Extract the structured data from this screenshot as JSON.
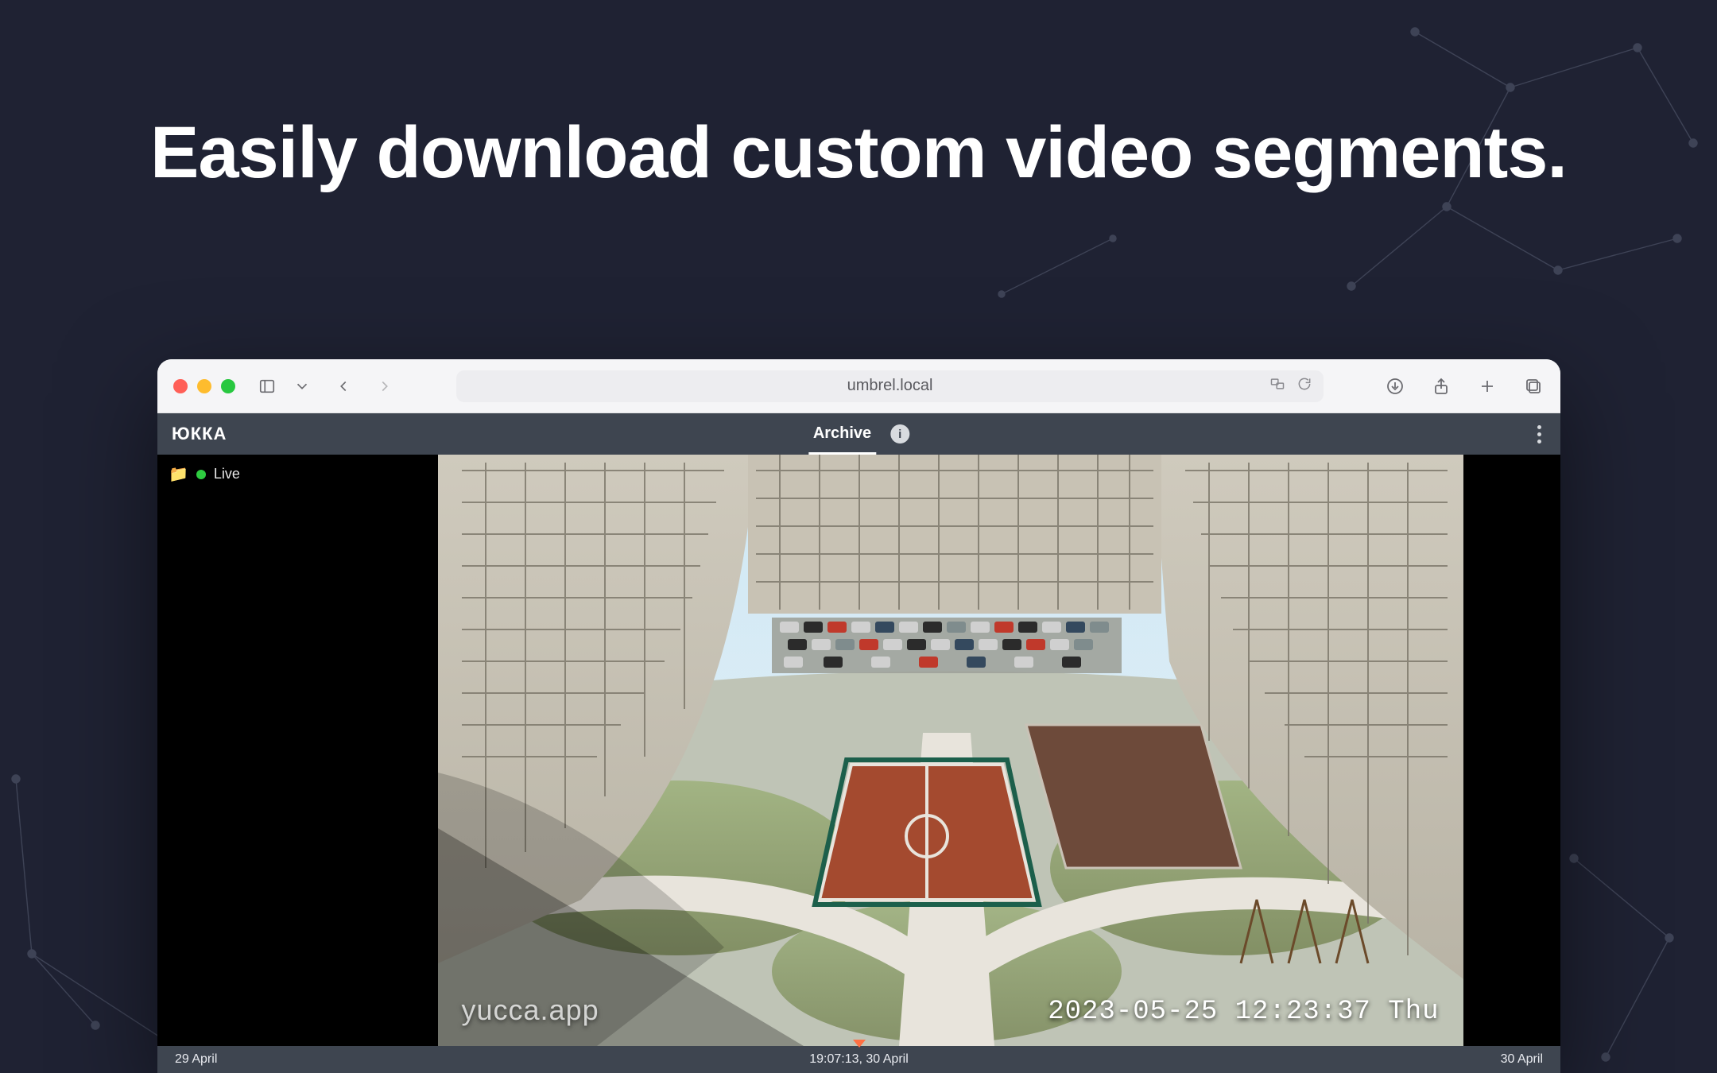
{
  "headline": "Easily download custom video segments.",
  "browser": {
    "url": "umbrel.local"
  },
  "app": {
    "logo": "ЮККА",
    "tab_label": "Archive",
    "info_glyph": "i",
    "sidebar": {
      "item_label": "Live"
    },
    "frame": {
      "watermark": "yucca.app",
      "osd_timestamp": "2023-05-25 12:23:37 Thu"
    },
    "timeline": {
      "left_label": "29 April",
      "center_label": "19:07:13, 30 April",
      "right_label": "30 April"
    }
  }
}
